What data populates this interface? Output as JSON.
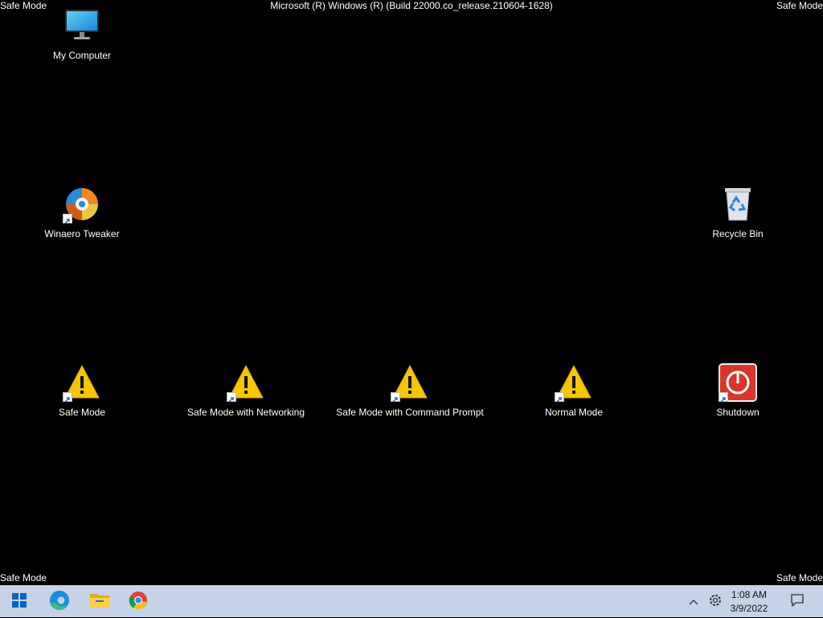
{
  "watermark": {
    "top_left": "Safe Mode",
    "top_right": "Safe Mode",
    "bottom_left": "Safe Mode",
    "bottom_right": "Safe Mode",
    "build": "Microsoft (R) Windows (R) (Build 22000.co_release.210604-1628)"
  },
  "desktop_icons": {
    "my_computer": "My Computer",
    "winaero": "Winaero Tweaker",
    "recycle_bin": "Recycle Bin",
    "safe_mode": "Safe Mode",
    "safe_mode_networking": "Safe Mode with Networking",
    "safe_mode_cmd": "Safe Mode with Command Prompt",
    "normal_mode": "Normal Mode",
    "shutdown": "Shutdown"
  },
  "taskbar": {
    "apps": [
      "start-icon",
      "edge-icon",
      "file-explorer-icon",
      "chrome-icon"
    ],
    "clock_time": "1:08 AM",
    "clock_date": "3/9/2022"
  },
  "colors": {
    "desktop_bg": "#000000",
    "taskbar_bg": "#c6d2e6",
    "warning_yellow": "#f7c600",
    "shutdown_red": "#d9352b"
  }
}
